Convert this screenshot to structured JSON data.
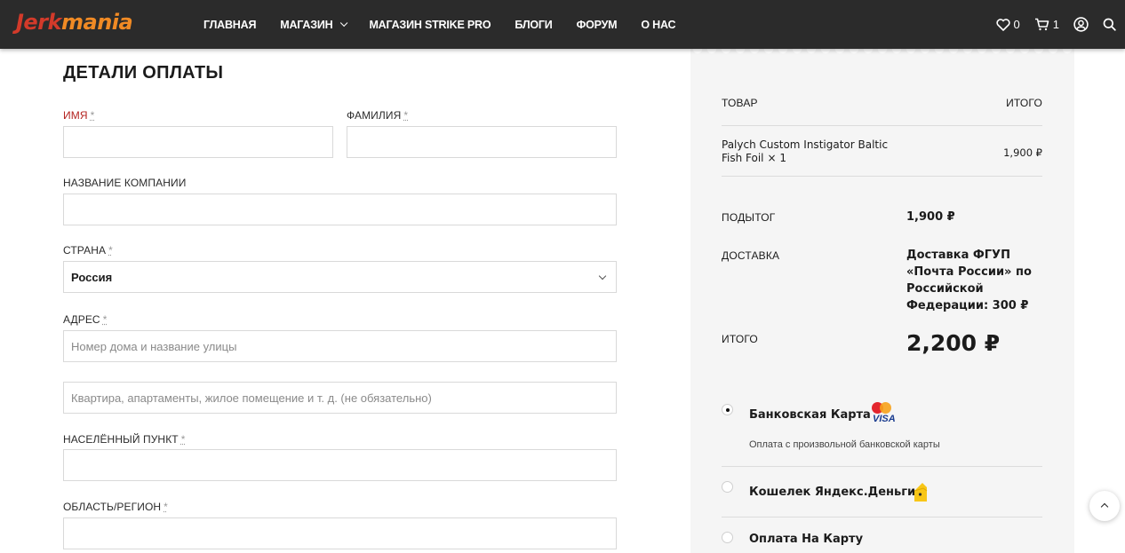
{
  "header": {
    "logo_text_a": "Jerk",
    "logo_text_b": "mania",
    "nav": [
      {
        "label": "ГЛАВНАЯ"
      },
      {
        "label": "МАГАЗИН",
        "has_dropdown": true
      },
      {
        "label": "МАГАЗИН STRIKE PRO"
      },
      {
        "label": "БЛОГИ"
      },
      {
        "label": "ФОРУМ"
      },
      {
        "label": "О НАС"
      }
    ],
    "wishlist_count": "0",
    "cart_count": "1",
    "icons": [
      "heart-icon",
      "cart-icon",
      "user-icon",
      "search-icon"
    ]
  },
  "form": {
    "title": "ДЕТАЛИ ОПЛАТЫ",
    "required_mark": "*",
    "first_name_label": "ИМЯ",
    "last_name_label": "ФАМИЛИЯ",
    "company_label": "НАЗВАНИЕ КОМПАНИИ",
    "country_label": "СТРАНА",
    "country_value": "Россия",
    "address_label": "АДРЕС",
    "address_placeholder": "Номер дома и название улицы",
    "address2_placeholder": "Квартира, апартаменты, жилое помещение и т. д. (не обязательно)",
    "city_label": "НАСЕЛЁННЫЙ ПУНКТ",
    "region_label": "ОБЛАСТЬ/РЕГИОН"
  },
  "order": {
    "col_product": "ТОВАР",
    "col_total": "ИТОГО",
    "product_name": "Palych Custom Instigator Baltic Fish Foil",
    "product_qty": "× 1",
    "product_price": "1,900 ₽",
    "subtotal_label": "ПОДЫТОГ",
    "subtotal_value": "1,900 ₽",
    "shipping_label": "ДОСТАВКА",
    "shipping_value": "Доставка ФГУП «Почта России» по Российской Федерации: 300 ₽",
    "total_label": "ИТОГО",
    "total_value": "2,200 ₽",
    "payment_methods": [
      {
        "label": "Банковская Карта",
        "selected": true,
        "description": "Оплата с произвольной банковской карты",
        "icon": "mastercard-visa-icon"
      },
      {
        "label": "Кошелек Яндекс.Деньги",
        "selected": false,
        "icon": "yandex-money-icon"
      },
      {
        "label": "Оплата На Карту",
        "selected": false
      }
    ],
    "visa_text": "VISA"
  },
  "colors": {
    "header_bg": "#2b2b2b",
    "accent_red": "#b4231f",
    "order_bg": "#f5f5f5"
  }
}
